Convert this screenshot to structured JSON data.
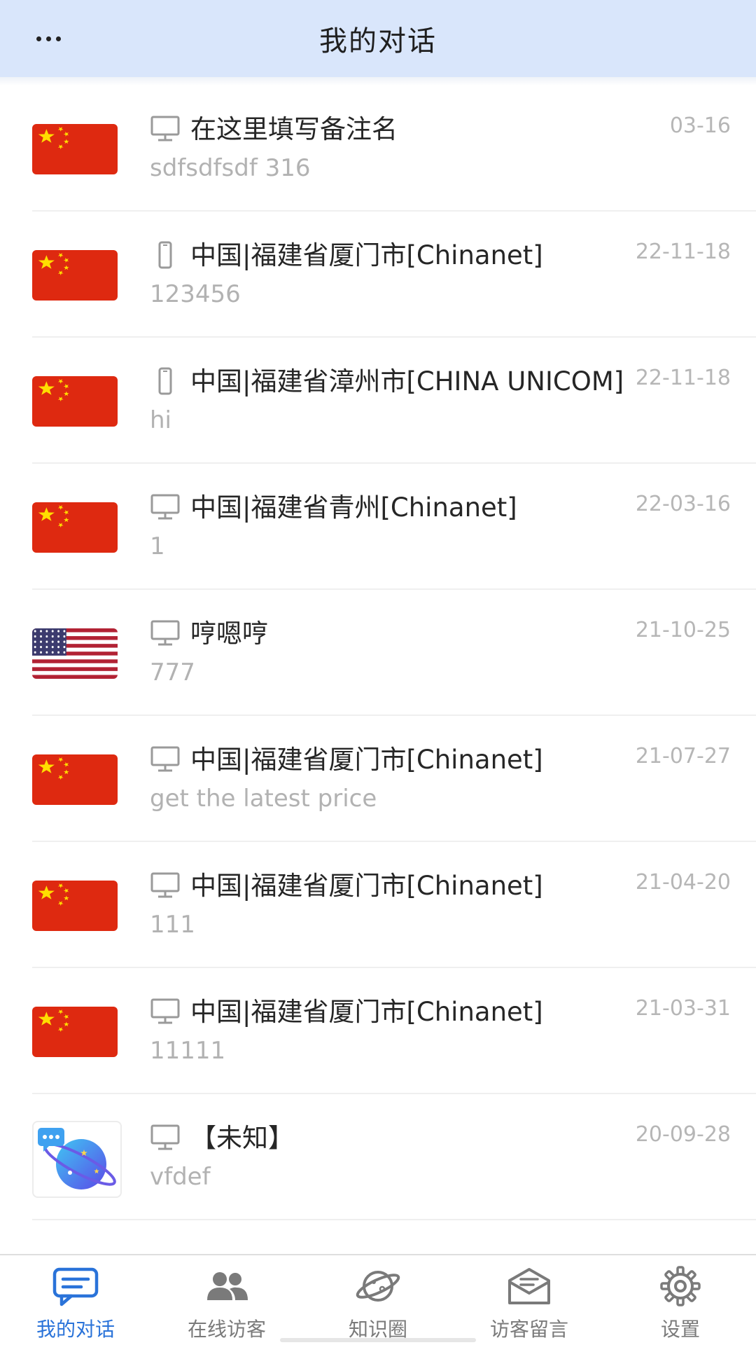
{
  "header": {
    "title": "我的对话",
    "more_icon": "ellipsis-icon"
  },
  "conversations": [
    {
      "flag": "cn",
      "device": "desktop",
      "title": "在这里填写备注名",
      "message": "sdfsdfsdf 316",
      "time": "03-16"
    },
    {
      "flag": "cn",
      "device": "mobile",
      "title": "中国|福建省厦门市[Chinanet]",
      "message": "123456",
      "time": "22-11-18"
    },
    {
      "flag": "cn",
      "device": "mobile",
      "title": "中国|福建省漳州市[CHINA UNICOM]",
      "message": "hi",
      "time": "22-11-18"
    },
    {
      "flag": "cn",
      "device": "desktop",
      "title": "中国|福建省青州[Chinanet]",
      "message": "1",
      "time": "22-03-16"
    },
    {
      "flag": "us",
      "device": "desktop",
      "title": "哼嗯哼",
      "message": "777",
      "time": "21-10-25"
    },
    {
      "flag": "cn",
      "device": "desktop",
      "title": "中国|福建省厦门市[Chinanet]",
      "message": "get the latest price",
      "time": "21-07-27"
    },
    {
      "flag": "cn",
      "device": "desktop",
      "title": "中国|福建省厦门市[Chinanet]",
      "message": "111",
      "time": "21-04-20"
    },
    {
      "flag": "cn",
      "device": "desktop",
      "title": "中国|福建省厦门市[Chinanet]",
      "message": "11111",
      "time": "21-03-31"
    },
    {
      "flag": "app",
      "device": "desktop",
      "title": "【未知】",
      "message": "vfdef",
      "time": "20-09-28"
    }
  ],
  "tabs": [
    {
      "label": "我的对话",
      "icon": "chat-bubble-icon",
      "active": true
    },
    {
      "label": "在线访客",
      "icon": "users-icon",
      "active": false
    },
    {
      "label": "知识圈",
      "icon": "planet-icon",
      "active": false
    },
    {
      "label": "访客留言",
      "icon": "envelope-icon",
      "active": false
    },
    {
      "label": "设置",
      "icon": "gear-icon",
      "active": false
    }
  ],
  "colors": {
    "header_bg": "#d9e6fb",
    "active_tab": "#2a73d9",
    "inactive_tab": "#7a7a7a",
    "cn_flag_red": "#de2910",
    "cn_flag_star": "#ffde00"
  }
}
